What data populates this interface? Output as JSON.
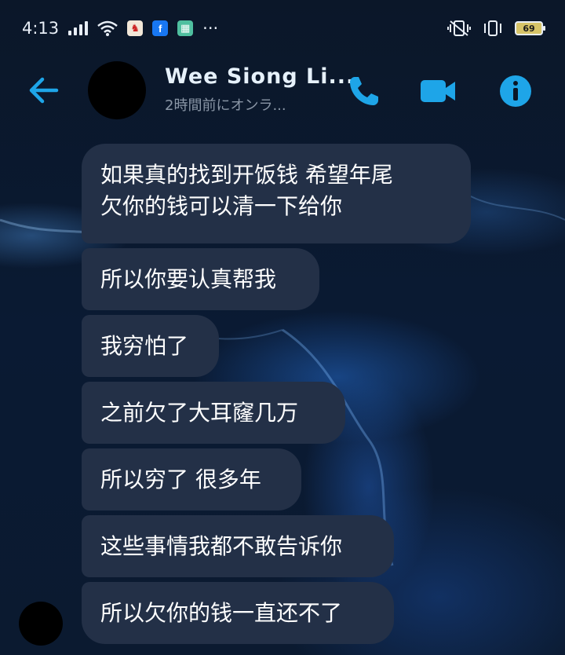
{
  "status_bar": {
    "time": "4:13",
    "more": "···",
    "battery": "69"
  },
  "header": {
    "contact_name": "Wee Siong Li...",
    "contact_status": "2時間前にオンラ..."
  },
  "messages": [
    {
      "line1": "如果真的找到开饭钱 希望年尾",
      "line2": "欠你的钱可以清一下给你"
    },
    {
      "line1": "所以你要认真帮我"
    },
    {
      "line1": "我穷怕了"
    },
    {
      "line1": "之前欠了大耳窿几万"
    },
    {
      "line1": "所以穷了 很多年"
    },
    {
      "line1": "这些事情我都不敢告诉你"
    },
    {
      "line1": "所以欠你的钱一直还不了"
    }
  ],
  "colors": {
    "accent": "#1ea5e8",
    "bubble": "#233047",
    "background": "#0a1626"
  },
  "icons": [
    "back-arrow-icon",
    "phone-icon",
    "video-camera-icon",
    "info-icon",
    "wifi-icon",
    "signal-icon",
    "vibrate-icon",
    "battery-icon"
  ]
}
